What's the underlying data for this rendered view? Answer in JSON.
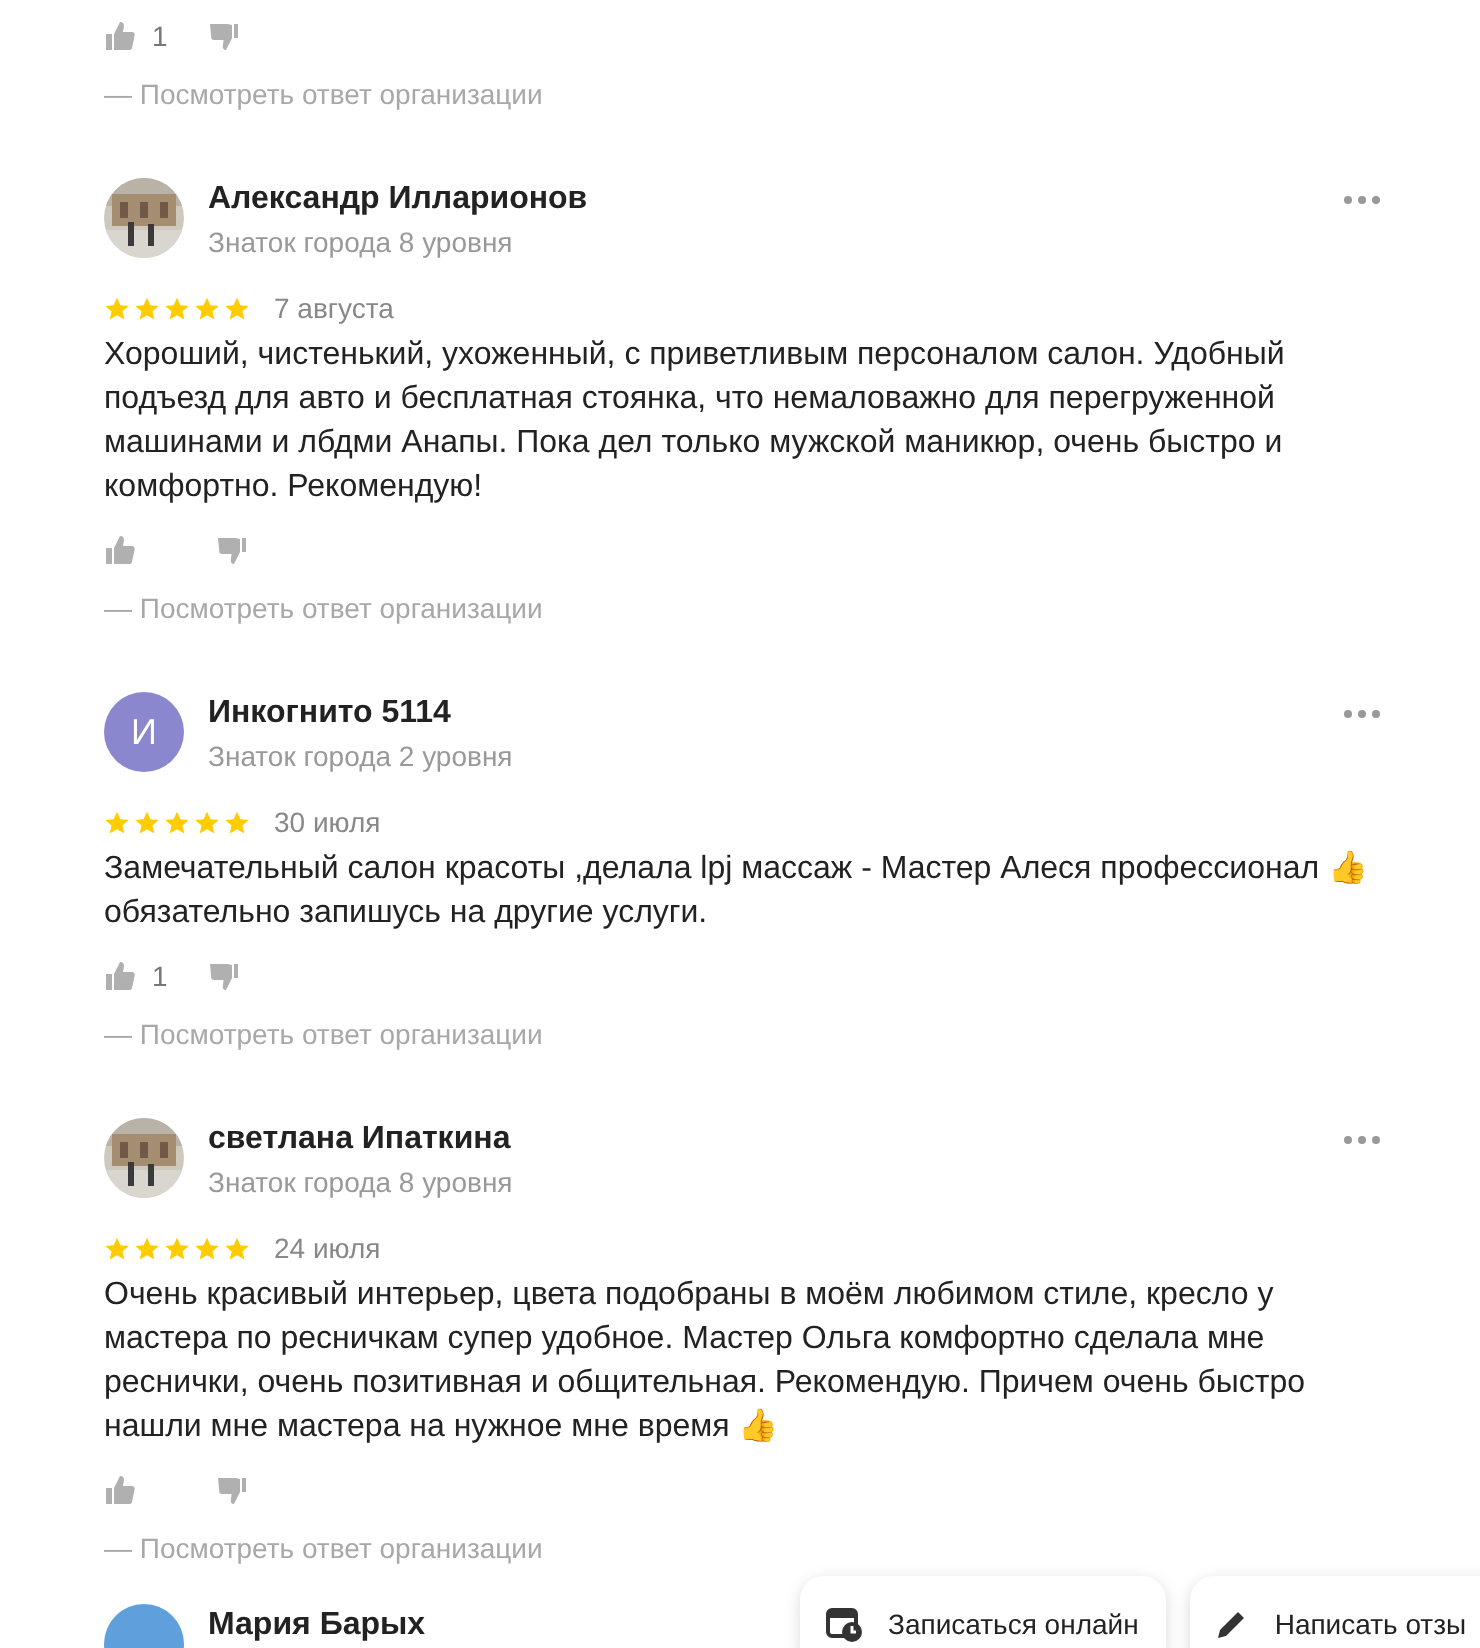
{
  "previous_review": {
    "likes": "1",
    "answer_link": "— Посмотреть ответ организации"
  },
  "reviews": [
    {
      "name": "Александр Илларионов",
      "level": "Знаток города 8 уровня",
      "stars": 5,
      "date": "7 августа",
      "text": "Хороший, чистенький, ухоженный, с приветливым персоналом салон. Удобный подъезд для авто и бесплатная стоянка, что немаловажно для перегруженной машинами и лбдми Анапы. Пока дел только мужской маникюр, очень быстро и комфортно. Рекомендую!",
      "answer_link": "— Посмотреть ответ организации"
    },
    {
      "avatar": {
        "kind": "initial",
        "letter": "И",
        "color": "#8a87cf"
      },
      "name": "Инкогнито 5114",
      "level": "Знаток города 2 уровня",
      "stars": 5,
      "date": "30 июля",
      "text": "Замечательный салон красоты ,делала lpj массаж - Мастер Алеся профессионал 👍 обязательно запишусь на другие услуги.",
      "likes": "1",
      "answer_link": "— Посмотреть ответ организации"
    },
    {
      "name": "светлана Ипаткина",
      "level": "Знаток города 8 уровня",
      "stars": 5,
      "date": "24 июля",
      "text": "Очень красивый интерьер, цвета подобраны в моём любимом стиле, кресло у мастера по ресничкам супер удобное. Мастер Ольга комфортно сделала мне реснички, очень позитивная и общительная. Рекомендую. Причем очень быстро нашли мне мастера на нужное мне время 👍",
      "answer_link": "— Посмотреть ответ организации"
    }
  ],
  "next_review": {
    "avatar": {
      "kind": "blank",
      "color": "#5e9fdc"
    },
    "name": "Мария Барых"
  },
  "action_buttons": [
    {
      "kind": "booking",
      "label": "Записаться онлайн"
    },
    {
      "kind": "write",
      "label": "Написать отзы"
    }
  ]
}
